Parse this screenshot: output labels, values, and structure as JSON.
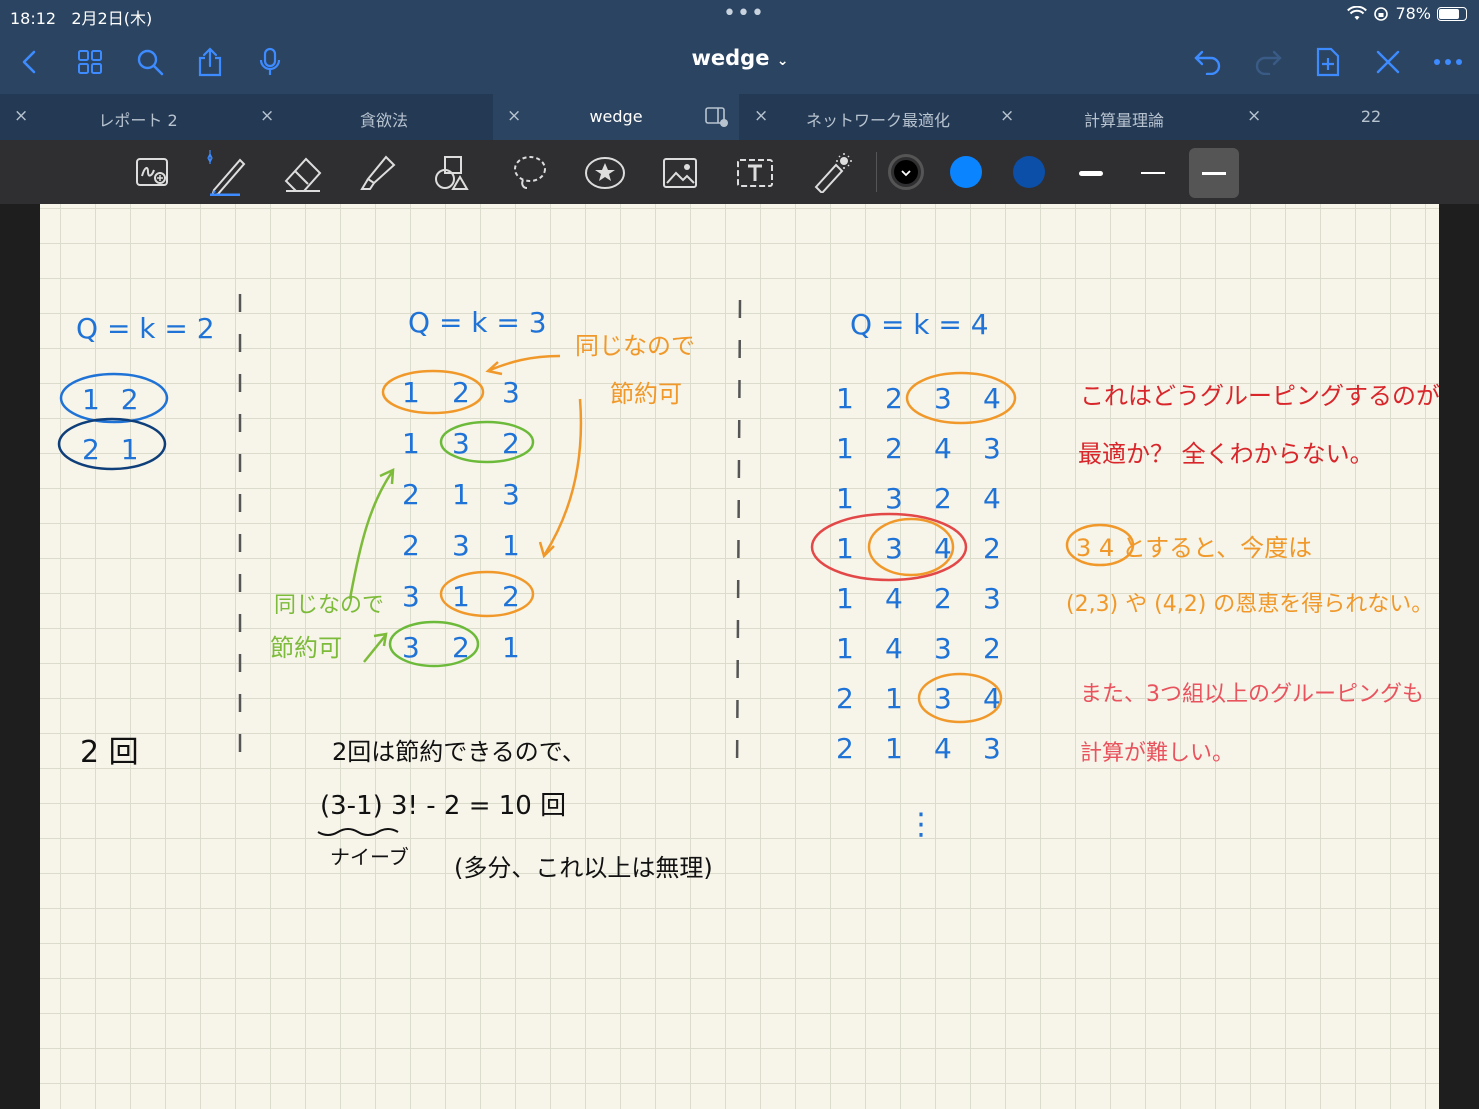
{
  "status": {
    "time": "18:12",
    "date": "2月2日(木)",
    "dots": "•••",
    "battery": "78%",
    "battery_level": 0.78
  },
  "nav": {
    "title": "wedge",
    "title_chevron": "⌄"
  },
  "tabs": [
    {
      "label": "レポート 2",
      "active": false
    },
    {
      "label": "貪欲法",
      "active": false
    },
    {
      "label": "wedge",
      "active": true
    },
    {
      "label": "ネットワーク最適化",
      "active": false
    },
    {
      "label": "計算量理論",
      "active": false
    },
    {
      "label": "22",
      "active": false
    }
  ],
  "tab_close": "×",
  "toolbar": {
    "colors": [
      "#000000",
      "#0a84ff",
      "#0b4fa8"
    ],
    "selected_weight": "thick"
  },
  "note": {
    "col1": {
      "heading": "Q = k = 2",
      "rows": [
        "1 2",
        "2 1"
      ],
      "total": "2 回"
    },
    "col2": {
      "heading": "Q = k = 3",
      "rows": [
        "1 2 3",
        "1 3 2",
        "2 1 3",
        "2 3 1",
        "3 1 2",
        "3 2 1"
      ],
      "note_orange": [
        "同じなので",
        "節約可"
      ],
      "note_green": [
        "同じなので",
        "節約可"
      ],
      "line1": "2回は節約できるので、",
      "formula": "(3-1) 3! - 2 = 10 回",
      "naive": "ナイーブ",
      "aside": "(多分、これ以上は無理)"
    },
    "col3": {
      "heading": "Q = k = 4",
      "rows": [
        "1 2 3 4",
        "1 2 4 3",
        "1 3 2 4",
        "1 3 4 2",
        "1 4 2 3",
        "1 4 3 2",
        "2 1 3 4",
        "2 1 4 3"
      ],
      "ellipsis": "⋮"
    },
    "remarks": {
      "red1": "これはどうグルーピングするのが",
      "red2": "最適か？ 全くわからない。",
      "orange1": "3 4 とすると、今度は",
      "orange2": "(2,3) や (4,2) の恩恵を得られない。",
      "pink1": "また、3つ組以上のグルーピングも",
      "pink2": "計算が難しい。"
    }
  }
}
